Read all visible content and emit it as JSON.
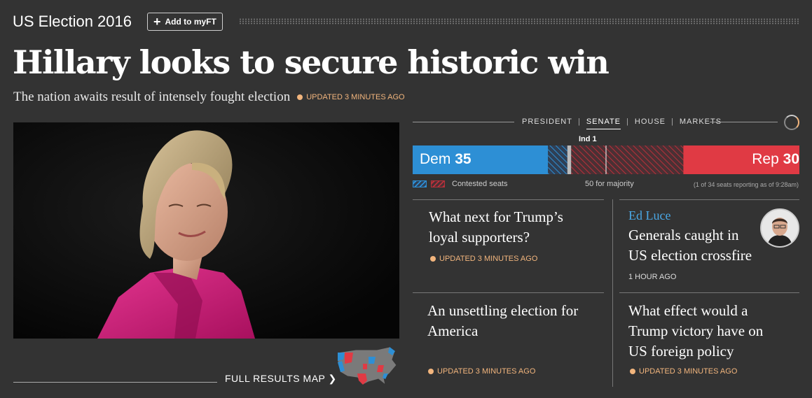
{
  "header": {
    "section_title": "US Election 2016",
    "add_button": "Add to myFT"
  },
  "lead": {
    "headline": "Hillary looks to secure historic win",
    "standfirst": "The nation awaits result of intensely fought election",
    "updated": "UPDATED 3 MINUTES AGO"
  },
  "map_link": {
    "label": "FULL RESULTS MAP ❯"
  },
  "results": {
    "tabs": [
      "PRESIDENT",
      "SENATE",
      "HOUSE",
      "MARKETS"
    ],
    "active_tab": "SENATE",
    "ind_label": "Ind 1",
    "dem_name": "Dem",
    "dem_seats": 35,
    "rep_name": "Rep",
    "rep_seats": 30,
    "dem_contested_seats": 5,
    "ind_seats": 1,
    "rep_contested_seats": 29,
    "total_seats": 100,
    "majority_seats": 50,
    "legend_contested": "Contested seats",
    "majority_label": "50 for majority",
    "reporting_note": "(1 of 34 seats reporting as of 9:28am)",
    "colors": {
      "dem": "#2d8fd5",
      "rep": "#e03a44",
      "ind": "#bbbbbb"
    }
  },
  "stories": [
    {
      "title_line1": "What next for Trump’s",
      "title_line2": "loyal supporters?",
      "meta": "UPDATED 3 MINUTES AGO"
    },
    {
      "byline": "Ed Luce",
      "title_line1": "Generals caught in",
      "title_line2": "US election crossfire",
      "meta": "1 HOUR AGO"
    },
    {
      "title_line1": "An unsettling election for",
      "title_line2": "America",
      "meta": "UPDATED 3 MINUTES AGO"
    },
    {
      "title_line1": "What effect would a",
      "title_line2": "Trump victory have on",
      "title_line3": "US foreign policy",
      "meta": "UPDATED 3 MINUTES AGO"
    }
  ],
  "icons": {
    "add": "plus-icon",
    "loading": "spinner-icon",
    "map": "us-map-icon",
    "avatar": "avatar-photo"
  },
  "accent_color": "#f2b57d"
}
